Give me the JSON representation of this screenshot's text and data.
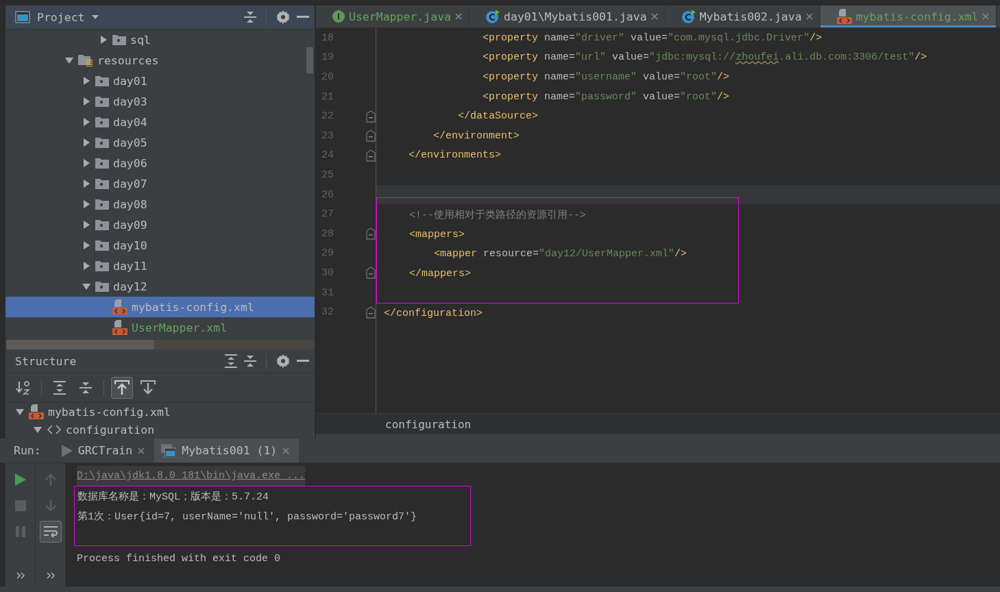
{
  "project": {
    "title": "Project",
    "tree": [
      {
        "children": [
          {
            "children": [
              {
                "label": "sql",
                "kind": "folder",
                "expanded": false,
                "selected": false,
                "color": "#bbbbbb"
              }
            ]
          }
        ]
      },
      {
        "label": "resources",
        "kind": "resources",
        "expanded": true,
        "selected": false,
        "color": "#bbbbbb",
        "children": [
          {
            "label": "day01",
            "kind": "folder",
            "expanded": false,
            "selected": false,
            "color": "#bbbbbb"
          },
          {
            "label": "day03",
            "kind": "folder",
            "expanded": false,
            "selected": false,
            "color": "#bbbbbb"
          },
          {
            "label": "day04",
            "kind": "folder",
            "expanded": false,
            "selected": false,
            "color": "#bbbbbb"
          },
          {
            "label": "day05",
            "kind": "folder",
            "expanded": false,
            "selected": false,
            "color": "#bbbbbb"
          },
          {
            "label": "day06",
            "kind": "folder",
            "expanded": false,
            "selected": false,
            "color": "#bbbbbb"
          },
          {
            "label": "day07",
            "kind": "folder",
            "expanded": false,
            "selected": false,
            "color": "#bbbbbb"
          },
          {
            "label": "day08",
            "kind": "folder",
            "expanded": false,
            "selected": false,
            "color": "#bbbbbb"
          },
          {
            "label": "day09",
            "kind": "folder",
            "expanded": false,
            "selected": false,
            "color": "#bbbbbb"
          },
          {
            "label": "day10",
            "kind": "folder",
            "expanded": false,
            "selected": false,
            "color": "#bbbbbb"
          },
          {
            "label": "day11",
            "kind": "folder",
            "expanded": false,
            "selected": false,
            "color": "#bbbbbb"
          },
          {
            "label": "day12",
            "kind": "folder",
            "expanded": true,
            "selected": false,
            "color": "#bbbbbb",
            "children": [
              {
                "label": "mybatis-config.xml",
                "kind": "xml",
                "selected": true,
                "color": "#bbbbbb"
              },
              {
                "label": "UserMapper.xml",
                "kind": "xml",
                "selected": false,
                "color": "#62a35c"
              }
            ]
          }
        ]
      }
    ]
  },
  "tabs": [
    {
      "label": "UserMapper.java",
      "kind": "interface",
      "selected": false,
      "color": "#62a35c"
    },
    {
      "label": "day01\\Mybatis001.java",
      "kind": "class",
      "selected": false,
      "color": "#bbbbbb"
    },
    {
      "label": "Mybatis002.java",
      "kind": "class",
      "selected": false,
      "color": "#bbbbbb"
    },
    {
      "label": "mybatis-config.xml",
      "kind": "xml",
      "selected": true,
      "color": "#62a35c"
    }
  ],
  "editor": {
    "lines": [
      {
        "number": "18",
        "tokens": [
          {
            "kind": "tag",
            "text": "                <property"
          },
          {
            "kind": "attr",
            "text": " name="
          },
          {
            "kind": "value",
            "text": "\"driver\""
          },
          {
            "kind": "attr",
            "text": " value="
          },
          {
            "kind": "value",
            "text": "\"com.mysql.jdbc.Driver\""
          },
          {
            "kind": "tag",
            "text": "/>"
          }
        ]
      },
      {
        "number": "19",
        "tokens": [
          {
            "kind": "tag",
            "text": "                <property"
          },
          {
            "kind": "attr",
            "text": " name="
          },
          {
            "kind": "value",
            "text": "\"url\""
          },
          {
            "kind": "attr",
            "text": " value="
          },
          {
            "kind": "value",
            "text": "\"jdbc:mysql://"
          },
          {
            "kind": "typo",
            "text": "zhoufei"
          },
          {
            "kind": "value",
            "text": ".ali.db.com:3306/test\""
          },
          {
            "kind": "tag",
            "text": "/>"
          }
        ]
      },
      {
        "number": "20",
        "tokens": [
          {
            "kind": "tag",
            "text": "                <property"
          },
          {
            "kind": "attr",
            "text": " name="
          },
          {
            "kind": "value",
            "text": "\"username\""
          },
          {
            "kind": "attr",
            "text": " value="
          },
          {
            "kind": "value",
            "text": "\"root\""
          },
          {
            "kind": "tag",
            "text": "/>"
          }
        ]
      },
      {
        "number": "21",
        "tokens": [
          {
            "kind": "tag",
            "text": "                <property"
          },
          {
            "kind": "attr",
            "text": " name="
          },
          {
            "kind": "value",
            "text": "\"password\""
          },
          {
            "kind": "attr",
            "text": " value="
          },
          {
            "kind": "value",
            "text": "\"root\""
          },
          {
            "kind": "tag",
            "text": "/>"
          }
        ]
      },
      {
        "number": "22",
        "fold": true,
        "tokens": [
          {
            "kind": "tag",
            "text": "            </dataSource>"
          }
        ]
      },
      {
        "number": "23",
        "fold": true,
        "tokens": [
          {
            "kind": "tag",
            "text": "        </environment>"
          }
        ]
      },
      {
        "number": "24",
        "fold": true,
        "tokens": [
          {
            "kind": "tag",
            "text": "    </environments>"
          }
        ]
      },
      {
        "number": "25"
      },
      {
        "number": "26",
        "current": true
      },
      {
        "number": "27",
        "boxed": true,
        "tokens": [
          {
            "kind": "comment",
            "text": "    <!--使用相对于类路径的资源引用-->"
          }
        ]
      },
      {
        "number": "28",
        "fold": true,
        "boxed": true,
        "tokens": [
          {
            "kind": "tag",
            "text": "    <mappers>"
          }
        ]
      },
      {
        "number": "29",
        "boxed": true,
        "tokens": [
          {
            "kind": "tag",
            "text": "        <mapper"
          },
          {
            "kind": "attr",
            "text": " resource="
          },
          {
            "kind": "value",
            "text": "\"day12/UserMapper.xml\""
          },
          {
            "kind": "tag",
            "text": "/>"
          }
        ]
      },
      {
        "number": "30",
        "fold": true,
        "boxed": true,
        "tokens": [
          {
            "kind": "tag",
            "text": "    </mappers>"
          }
        ]
      },
      {
        "number": "31",
        "boxed": true
      },
      {
        "number": "32",
        "fold": true,
        "tokens": [
          {
            "kind": "tag",
            "text": "</configuration>"
          }
        ]
      }
    ],
    "breadcrumb": "configuration"
  },
  "structure": {
    "title": "Structure",
    "toolbar": [
      {
        "on": false
      },
      {
        "on": false
      },
      {
        "on": false
      },
      {
        "on": true
      },
      {
        "on": false
      }
    ],
    "tree": [
      {
        "label": "mybatis-config.xml",
        "kind": "xml",
        "expanded": true,
        "children": [
          {
            "label": "configuration",
            "kind": "tag",
            "expanded": true
          }
        ]
      }
    ]
  },
  "run": {
    "label": "Run:",
    "tabs": [
      {
        "label": "GRCTrain",
        "kind": "run",
        "selected": false
      },
      {
        "label": "Mybatis001 (1)",
        "kind": "app",
        "selected": true
      }
    ],
    "toolbar": [
      {
        "on": false
      },
      {
        "on": false
      },
      {
        "on": false
      },
      {
        "on": false
      },
      {
        "on": false
      },
      {
        "on": true
      }
    ],
    "console": [
      {
        "kind": "command",
        "text": "D:\\java\\jdk1.8.0_181\\bin\\java.exe ...",
        "boxed": false
      },
      {
        "kind": "output",
        "text": "数据库名称是：MySQL；版本是：5.7.24",
        "boxed": true
      },
      {
        "kind": "output",
        "text": "第1次：User{id=7, userName='null', password='password7'}",
        "boxed": true
      },
      {
        "kind": "output",
        "text": "Process finished with exit code 0",
        "boxed": false
      }
    ]
  }
}
